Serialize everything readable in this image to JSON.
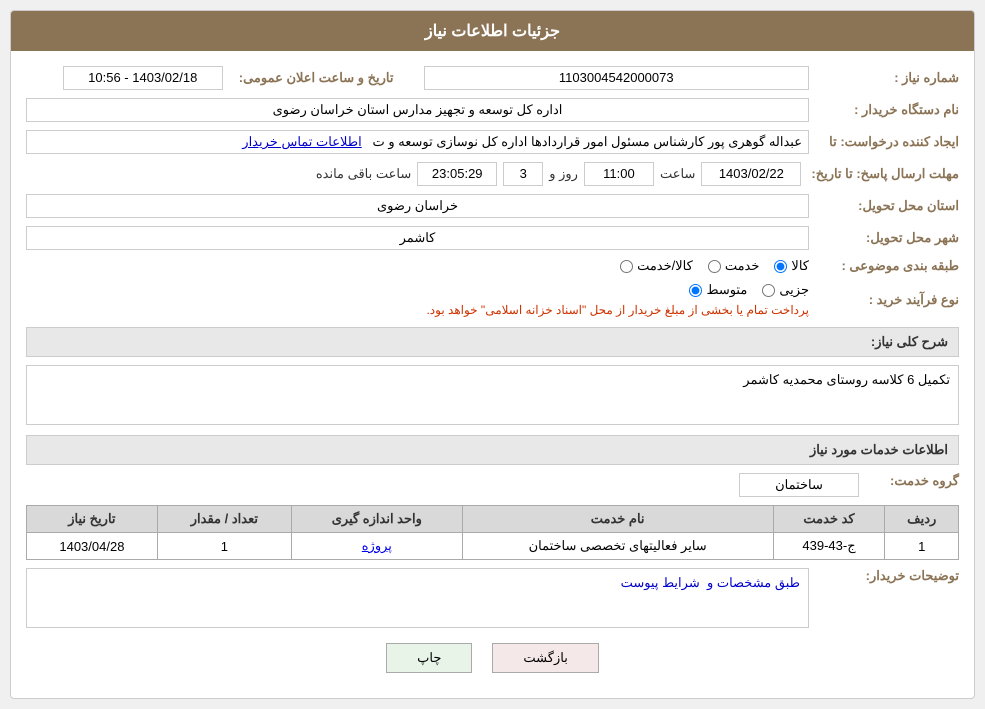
{
  "header": {
    "title": "جزئیات اطلاعات نیاز"
  },
  "fields": {
    "need_number_label": "شماره نیاز :",
    "need_number_value": "1103004542000073",
    "buyer_org_label": "نام دستگاه خریدار :",
    "buyer_org_value": "اداره کل توسعه  و تجهیز مدارس استان خراسان رضوی",
    "creator_label": "ایجاد کننده درخواست: تا",
    "creator_value": "عبداله گوهری پور کارشناس مسئول امور قراردادها  اداره کل نوسازی  توسعه و ت",
    "creator_link": "اطلاعات تماس خریدار",
    "announce_datetime_label": "تاریخ و ساعت اعلان عمومی:",
    "announce_datetime_value": "1403/02/18 - 10:56",
    "reply_deadline_label": "مهلت ارسال پاسخ: تا تاریخ:",
    "reply_date": "1403/02/22",
    "reply_time_label": "ساعت",
    "reply_time": "11:00",
    "reply_day_label": "روز و",
    "reply_days": "3",
    "reply_remaining_label": "ساعت باقی مانده",
    "reply_remaining": "23:05:29",
    "province_label": "استان محل تحویل:",
    "province_value": "خراسان رضوی",
    "city_label": "شهر محل تحویل:",
    "city_value": "کاشمر",
    "category_label": "طبقه بندی موضوعی :",
    "category_options": [
      "کالا",
      "خدمت",
      "کالا/خدمت"
    ],
    "category_selected": "کالا",
    "process_type_label": "نوع فرآیند خرید :",
    "process_options": [
      "جزیی",
      "متوسط"
    ],
    "process_note": "پرداخت تمام یا بخشی از مبلغ خریدار از محل \"اسناد خزانه اسلامی\" خواهد بود.",
    "need_desc_label": "شرح کلی نیاز:",
    "need_desc_value": "تکمیل 6 کلاسه روستای محمدیه کاشمر",
    "services_section": "اطلاعات خدمات مورد نیاز",
    "service_group_label": "گروه خدمت:",
    "service_group_value": "ساختمان",
    "table": {
      "headers": [
        "ردیف",
        "کد خدمت",
        "نام خدمت",
        "واحد اندازه گیری",
        "تعداد / مقدار",
        "تاریخ نیاز"
      ],
      "rows": [
        {
          "row": "1",
          "code": "ج-43-439",
          "name": "سایر فعالیتهای تخصصی ساختمان",
          "unit": "پروژه",
          "qty": "1",
          "date": "1403/04/28"
        }
      ]
    },
    "buyer_notes_label": "توضیحات خریدار:",
    "buyer_notes_value": "طبق مشخصات و  شرایط پیوست",
    "btn_print": "چاپ",
    "btn_back": "بازگشت"
  }
}
